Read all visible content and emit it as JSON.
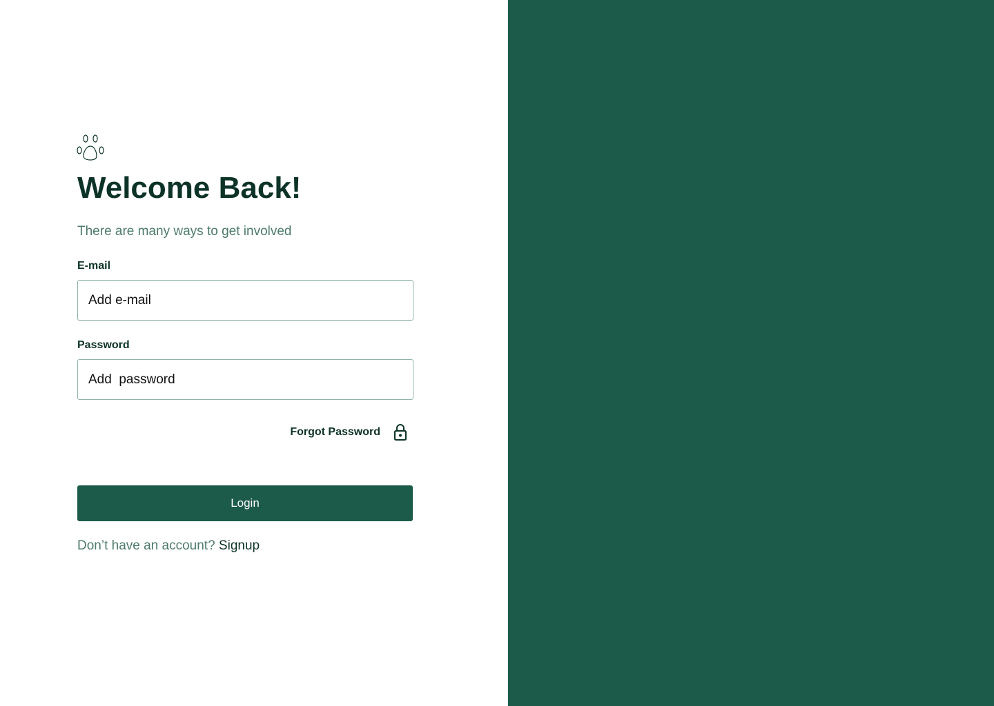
{
  "brand": {
    "logo_icon": "paw-print-icon",
    "primary_color": "#1c5a4a",
    "text_dark": "#0d3328",
    "text_muted": "#4c7a6c"
  },
  "login": {
    "title": "Welcome Back!",
    "subtitle": "There are many ways to get involved",
    "email": {
      "label": "E-mail",
      "placeholder": "Add e-mail",
      "value": ""
    },
    "password": {
      "label": "Password",
      "placeholder": "Add  password",
      "value": ""
    },
    "forgot_password": {
      "label": "Forgot Password",
      "icon": "lock-icon"
    },
    "submit_label": "Login",
    "signup_prompt": "Don’t have an account?",
    "signup_link": "Signup"
  },
  "side_panel": {
    "background": "#1c5a4a"
  }
}
